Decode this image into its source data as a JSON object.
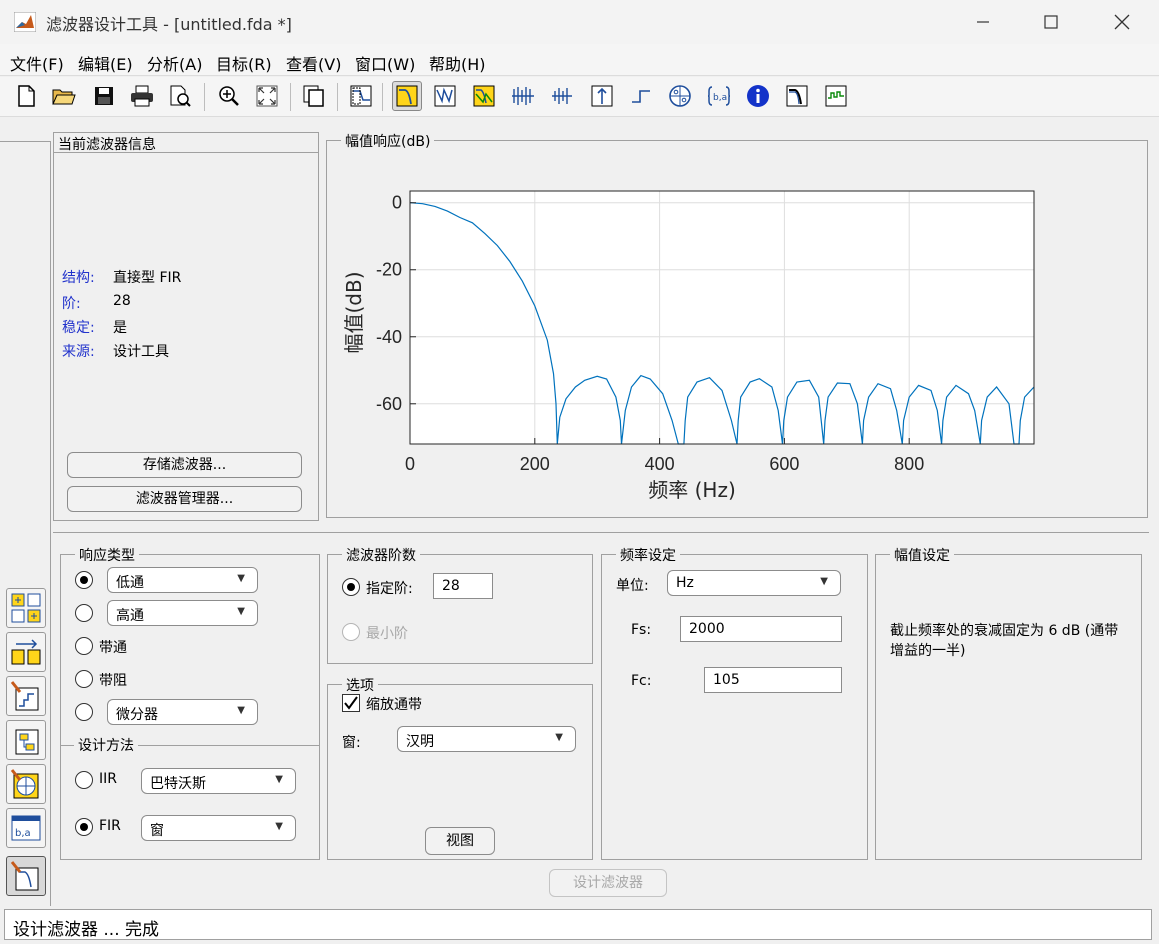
{
  "window": {
    "title": "滤波器设计工具 -  [untitled.fda *]",
    "controls": [
      "minimize",
      "maximize",
      "close"
    ]
  },
  "menu": [
    "文件(F)",
    "编辑(E)",
    "分析(A)",
    "目标(R)",
    "查看(V)",
    "窗口(W)",
    "帮助(H)"
  ],
  "toolbar_icons": [
    "new-file-icon",
    "open-folder-icon",
    "save-icon",
    "print-icon",
    "print-preview-icon",
    "zoom-in-icon",
    "full-view-icon",
    "new-figure-icon",
    "filter-specs-icon",
    "magnitude-response-icon",
    "phase-response-icon",
    "magnitude-phase-icon",
    "group-delay-icon",
    "phase-delay-icon",
    "impulse-response-icon",
    "step-response-icon",
    "pole-zero-icon",
    "coefficients-icon",
    "info-icon",
    "magnitude-estimate-icon",
    "round-off-noise-icon"
  ],
  "filter_info": {
    "title": "当前滤波器信息",
    "rows": [
      {
        "key": "结构:",
        "value": "直接型 FIR"
      },
      {
        "key": "阶:",
        "value": "28"
      },
      {
        "key": "稳定:",
        "value": "是"
      },
      {
        "key": "来源:",
        "value": "设计工具"
      }
    ],
    "store_button": "存储滤波器...",
    "manager_button": "滤波器管理器..."
  },
  "magnitude_panel": {
    "title": "幅值响应(dB)"
  },
  "chart_data": {
    "type": "line",
    "xlabel": "频率 (Hz)",
    "ylabel": "幅值(dB)",
    "xlim": [
      0,
      1000
    ],
    "ylim": [
      -72,
      3.5
    ],
    "xticks": [
      0,
      200,
      400,
      600,
      800
    ],
    "yticks": [
      0,
      -20,
      -40,
      -60
    ],
    "grid": true,
    "color": "#0072bd",
    "series": [
      {
        "x": [
          0,
          20,
          40,
          60,
          80,
          100,
          120,
          140,
          160,
          180,
          200,
          220,
          230,
          234,
          236,
          240,
          250,
          265,
          280,
          300,
          315,
          330,
          337,
          339,
          345,
          355,
          370,
          385,
          405,
          420,
          430,
          439,
          441,
          445,
          460,
          480,
          500,
          515,
          524,
          526,
          530,
          545,
          560,
          580,
          590,
          597,
          599,
          605,
          620,
          640,
          655,
          663,
          665,
          670,
          685,
          705,
          717,
          725,
          727,
          735,
          750,
          770,
          780,
          789,
          791,
          800,
          815,
          835,
          845,
          852,
          854,
          860,
          875,
          895,
          905,
          914,
          916,
          925,
          940,
          960,
          968,
          976,
          978,
          985,
          1000
        ],
        "y": [
          0,
          -0.3,
          -1.1,
          -2.5,
          -4.4,
          -6.0,
          -9.2,
          -12.8,
          -17.5,
          -23.4,
          -30.8,
          -41,
          -51,
          -60,
          -72,
          -64,
          -58.5,
          -55,
          -53,
          -51.8,
          -52.6,
          -58,
          -65,
          -72,
          -62,
          -55,
          -51.6,
          -52.6,
          -57,
          -65,
          -72,
          -72,
          -65,
          -58,
          -53.5,
          -52.2,
          -56,
          -65,
          -72,
          -65,
          -58,
          -53.5,
          -52.5,
          -55,
          -62,
          -72,
          -65,
          -58,
          -53.5,
          -53,
          -58,
          -72,
          -65,
          -58,
          -53.8,
          -54,
          -60,
          -72,
          -65,
          -58,
          -54,
          -55.5,
          -62,
          -72,
          -65,
          -58,
          -54.5,
          -56,
          -62,
          -72,
          -65,
          -58,
          -54.5,
          -57,
          -62,
          -72,
          -65,
          -58,
          -55,
          -60,
          -72,
          -72,
          -65,
          -58,
          -55
        ]
      }
    ]
  },
  "response_type": {
    "title": "响应类型",
    "options": [
      {
        "label": "",
        "combo": "低通",
        "selected": true
      },
      {
        "label": "",
        "combo": "高通",
        "selected": false
      },
      {
        "label": "带通",
        "combo": null,
        "selected": false
      },
      {
        "label": "带阻",
        "combo": null,
        "selected": false
      },
      {
        "label": "",
        "combo": "微分器",
        "selected": false
      }
    ]
  },
  "design_method": {
    "title": "设计方法",
    "iir_label": "IIR",
    "iir_combo": "巴特沃斯",
    "fir_label": "FIR",
    "fir_combo": "窗",
    "selected": "FIR"
  },
  "filter_order": {
    "title": "滤波器阶数",
    "specify_label": "指定阶:",
    "specify_value": "28",
    "minimum_label": "最小阶"
  },
  "options": {
    "title": "选项",
    "scale_passband_label": "缩放通带",
    "scale_passband_checked": true,
    "window_label": "窗:",
    "window_value": "汉明",
    "view_button": "视图"
  },
  "freq_spec": {
    "title": "频率设定",
    "units_label": "单位:",
    "units_value": "Hz",
    "fs_label": "Fs:",
    "fs_value": "2000",
    "fc_label": "Fc:",
    "fc_value": "105"
  },
  "mag_spec": {
    "title": "幅值设定",
    "note": "截止频率处的衰减固定为 6 dB (通带增益的一半)"
  },
  "design_button": "设计滤波器",
  "status": "设计滤波器 ... 完成"
}
